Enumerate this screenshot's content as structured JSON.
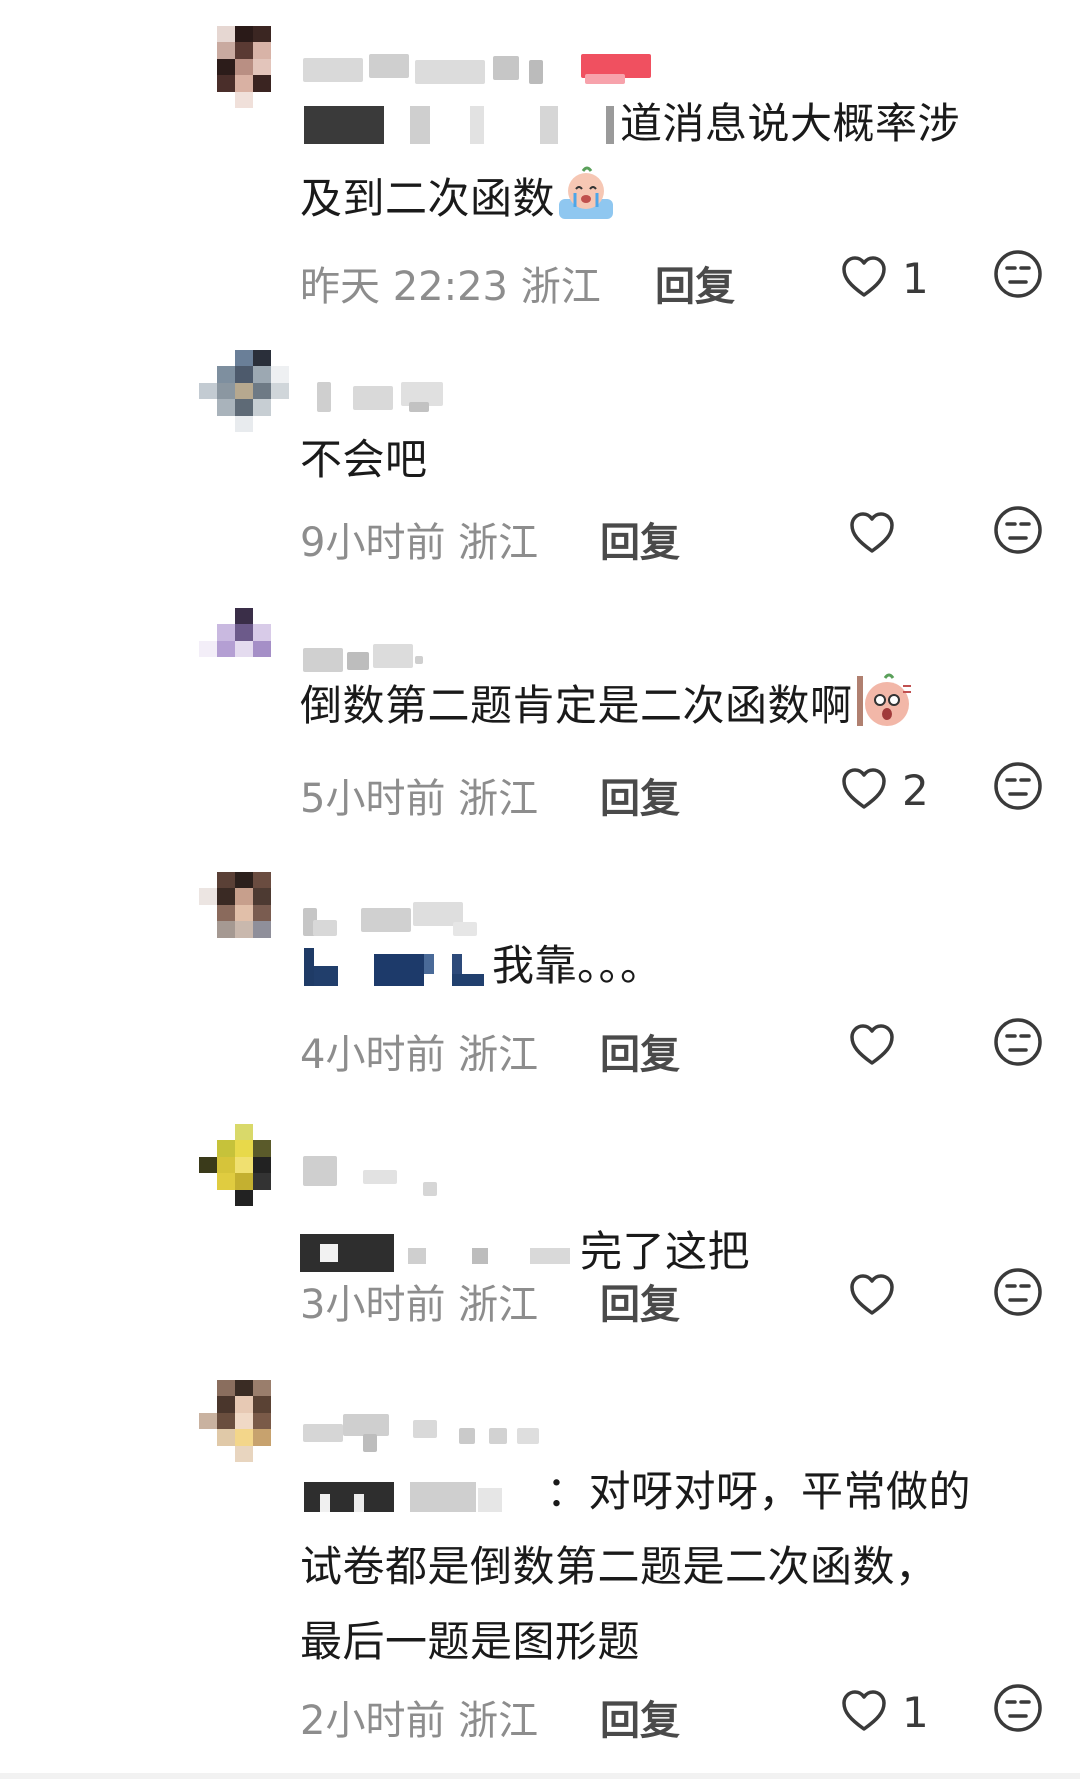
{
  "comments": [
    {
      "text_line1": "道消息说大概率涉",
      "text_line2": "及到二次函数",
      "time": "昨天 22:23",
      "location": "浙江",
      "reply_label": "回复",
      "likes": "1",
      "sticker": "crying-sticker"
    },
    {
      "text_line1": "不会吧",
      "time": "9小时前",
      "location": "浙江",
      "reply_label": "回复",
      "likes": ""
    },
    {
      "text_line1": "倒数第二题肯定是二次函数啊",
      "time": "5小时前",
      "location": "浙江",
      "reply_label": "回复",
      "likes": "2",
      "sticker": "shocked-sticker"
    },
    {
      "text_line1": "我靠。。。",
      "time": "4小时前",
      "location": "浙江",
      "reply_label": "回复",
      "likes": ""
    },
    {
      "text_line1": "完了这把",
      "time": "3小时前",
      "location": "浙江",
      "reply_label": "回复",
      "likes": ""
    },
    {
      "text_line1": "：对呀对呀，平常做的",
      "text_line2": "试卷都是倒数第二题是二次函数，",
      "text_line3": "最后一题是图形题",
      "time": "2小时前",
      "location": "浙江",
      "reply_label": "回复",
      "likes": "1"
    }
  ],
  "colors": {
    "meta_gray": "#8d8d8d",
    "text": "#1a1a1a",
    "icon": "#3a3a3a"
  },
  "icons": [
    "heart-icon",
    "dislike-face-icon"
  ]
}
